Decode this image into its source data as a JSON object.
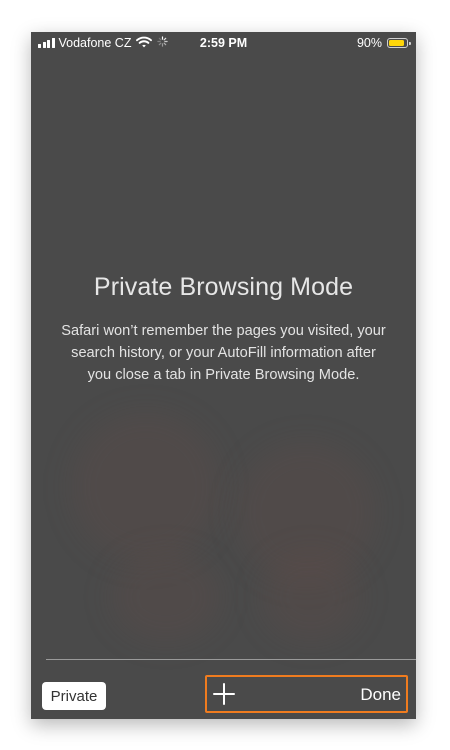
{
  "status_bar": {
    "carrier": "Vodafone CZ",
    "time": "2:59 PM",
    "battery_percent": "90%",
    "battery_level": 0.9,
    "signal_icon": "cellular-signal-icon",
    "wifi_icon": "wifi-icon",
    "activity_icon": "activity-spinner-icon",
    "battery_color": "#ffd60a"
  },
  "main": {
    "title": "Private Browsing Mode",
    "description": "Safari won’t remember the pages you visited, your search history, or your AutoFill information after you close a tab in Private Browsing Mode."
  },
  "toolbar": {
    "private_label": "Private",
    "new_tab_icon": "plus-icon",
    "done_label": "Done",
    "highlight_color": "#f07c1f"
  },
  "colors": {
    "background": "#4a4a4a",
    "text": "#e6e6e6"
  }
}
